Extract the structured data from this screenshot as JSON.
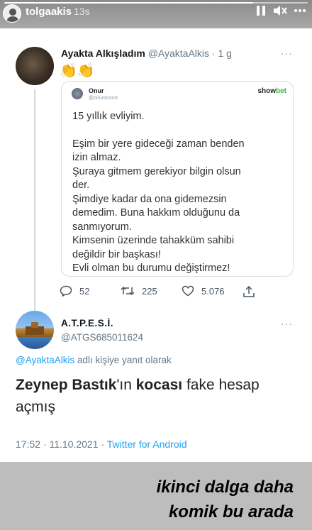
{
  "story": {
    "username": "tolgaakis",
    "time": "13s",
    "progress": 0.82,
    "caption_line1": "ikinci dalga daha",
    "caption_line2": "komik bu arada"
  },
  "tweet1": {
    "name": "Ayakta Alkışladım",
    "handle": "@AyaktaAlkis",
    "age": "· 1 g",
    "emoji": "👏👏",
    "more": "···",
    "quoted": {
      "name": "Onur",
      "handle": "@onurdmmrt",
      "brand_a": "show",
      "brand_b": "bet",
      "line1": "15 yıllık evliyim.",
      "line2": "Eşim bir yere gideceği zaman benden",
      "line3": "izin almaz.",
      "line4": "Şuraya gitmem gerekiyor bilgin olsun",
      "line5": "der.",
      "line6": "Şimdiye kadar da ona gidemezsin",
      "line7": "demedim. Buna hakkım olduğunu da",
      "line8": "sanmıyorum.",
      "line9": "Kimsenin üzerinde tahakküm sahibi",
      "line10": "değildir bir başkası!",
      "line11": "Evli olman bu durumu değiştirmez!"
    },
    "replies": "52",
    "retweets": "225",
    "likes": "5.076"
  },
  "tweet2": {
    "name": "A.T.P.E.S.İ.",
    "handle": "@ATGS685011624",
    "more": "···",
    "reply_mention": "@AyaktaAlkis",
    "reply_rest": " adlı kişiye yanıt olarak",
    "text_bold1": "Zeynep Bastık",
    "text_part1": "'ın ",
    "text_bold2": "kocası",
    "text_part2": " fake hesap",
    "text_line2": "açmış",
    "time": "17:52 · 11.10.2021 · ",
    "source": "Twitter for Android"
  },
  "colors": {
    "link": "#1da1f2",
    "secondary": "#657786",
    "showbet_green": "#39b54a"
  },
  "icons": [
    "pause-icon",
    "mute-icon",
    "more-icon",
    "reply-icon",
    "retweet-icon",
    "like-icon",
    "share-icon"
  ]
}
